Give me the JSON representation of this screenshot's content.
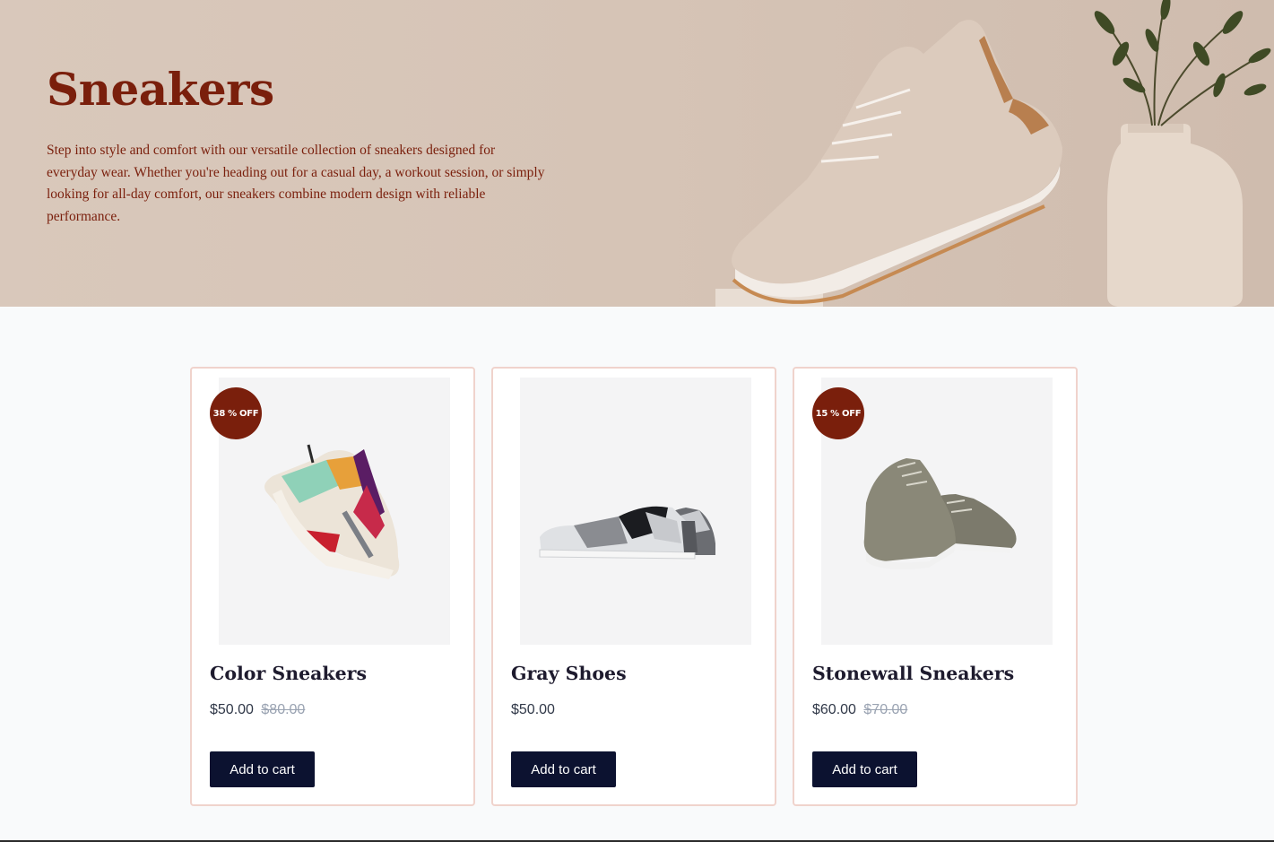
{
  "hero": {
    "title": "Sneakers",
    "description": "Step into style and comfort with our versatile collection of sneakers designed for everyday wear. Whether you're heading out for a casual day, a workout session, or simply looking for all-day comfort, our sneakers combine modern design with reliable performance.",
    "image": "sneaker-and-vase-photo"
  },
  "colors": {
    "accent": "#7a1f0c",
    "button": "#0c1230",
    "hero_bg": "#d6c4b6",
    "card_border": "#f0d3cc"
  },
  "products": [
    {
      "title": "Color Sneakers",
      "price": "$50.00",
      "old_price": "$80.00",
      "badge": "38 % OFF",
      "cta": "Add to cart",
      "image": "color-sneaker-photo"
    },
    {
      "title": "Gray Shoes",
      "price": "$50.00",
      "old_price": "",
      "badge": "",
      "cta": "Add to cart",
      "image": "gray-shoes-photo"
    },
    {
      "title": "Stonewall Sneakers",
      "price": "$60.00",
      "old_price": "$70.00",
      "badge": "15 % OFF",
      "cta": "Add to cart",
      "image": "stonewall-sneakers-photo"
    }
  ]
}
